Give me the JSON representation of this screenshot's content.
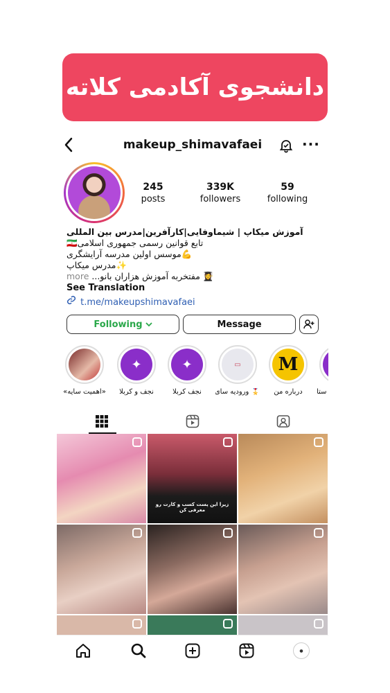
{
  "banner": {
    "text": "دانشجوی آکادمی کلاته",
    "color": "#ee4660"
  },
  "header": {
    "username": "makeup_shimavafaei",
    "back_icon": "chevron-left-icon",
    "bell_icon": "bell-icon",
    "more_icon": "more-icon"
  },
  "stats": [
    {
      "num": "245",
      "label": "posts"
    },
    {
      "num": "339K",
      "label": "followers"
    },
    {
      "num": "59",
      "label": "following"
    }
  ],
  "bio": {
    "name": "آموزش میکاپ | شیماوفایی|کارآفرین|مدرس بین المللی",
    "line1": "🇮🇷تابع قوانین رسمی جمهوری اسلامی",
    "line2": "💪موسس اولین مدرسه آرایشگری",
    "line3": "✨مدرس میکاپ",
    "line4": "👩‍🎓 مفتخربه آموزش هزاران بانو...",
    "more": "more",
    "translate": "See Translation",
    "link": "t.me/makeupshimavafaei"
  },
  "buttons": {
    "follow": "Following",
    "message": "Message"
  },
  "highlights": [
    {
      "label": "«اهمیت سایه»",
      "color": "#c23a3a"
    },
    {
      "label": "نجف و کربلا",
      "color": "#8a2ec9"
    },
    {
      "label": "نجف کربلا",
      "color": "#8a2ec9"
    },
    {
      "label": "🎖️ ورودیه سای...",
      "color": "#e8e8ee"
    },
    {
      "label": "درباره من",
      "color": "#f5c400"
    },
    {
      "label": "ستا",
      "color": "#8a2ec9"
    }
  ],
  "grid": {
    "cell2_text": "زیرا این پست کسب و کارت رو معرفی کن"
  },
  "nav": [
    "home-icon",
    "search-icon",
    "create-icon",
    "reels-icon",
    "profile-avatar"
  ],
  "colors": {
    "accent_green": "#2aa84a",
    "link_blue": "#2f5fb3"
  }
}
